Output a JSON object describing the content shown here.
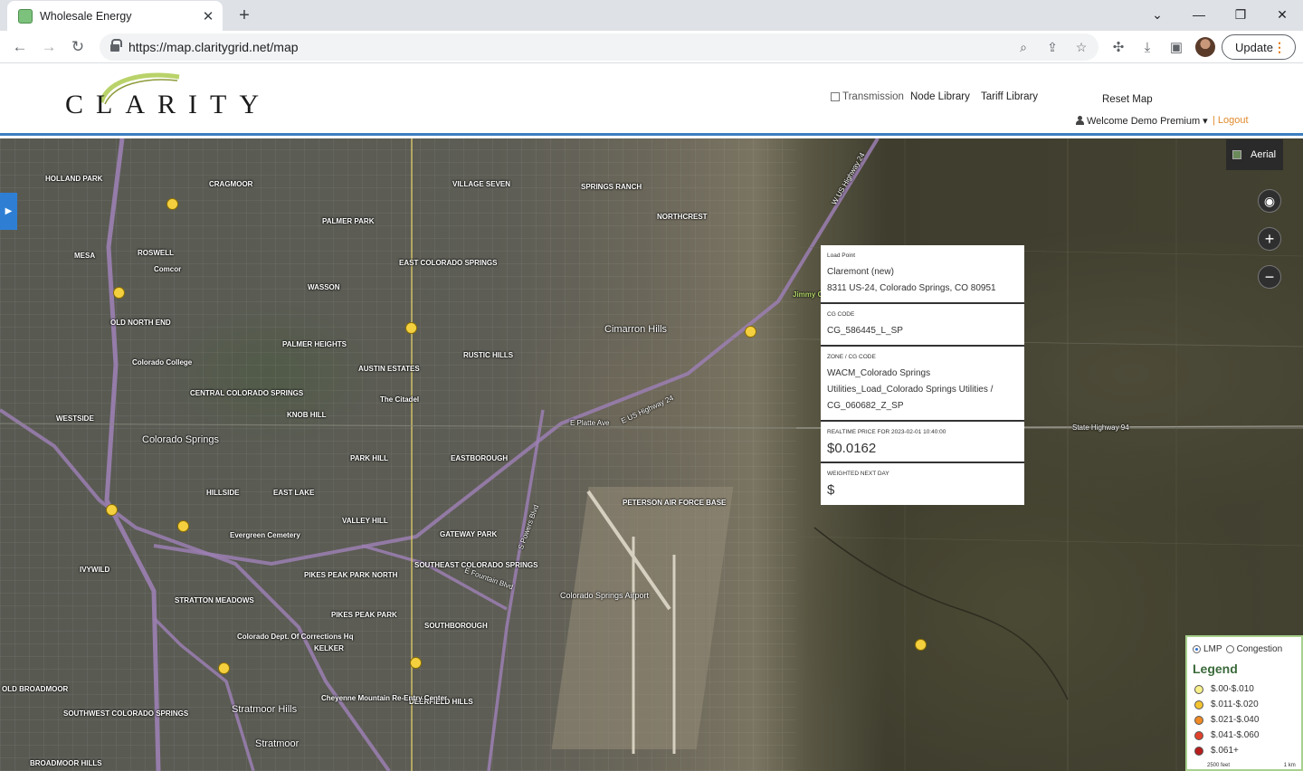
{
  "browser": {
    "tab_title": "Wholesale Energy",
    "url": "https://map.claritygrid.net/map",
    "update_label": "Update"
  },
  "header": {
    "logo_text": "CLARITY",
    "transmission_label": "Transmission",
    "node_library": "Node Library",
    "tariff_library": "Tariff Library",
    "reset_map": "Reset Map",
    "welcome": "Welcome Demo Premium",
    "logout": "| Logout"
  },
  "map": {
    "aerial_label": "Aerial",
    "labels": [
      "HOLLAND PARK",
      "CRAGMOOR",
      "ROSWELL",
      "Comcor",
      "MESA",
      "OLD NORTH END",
      "Colorado College",
      "CENTRAL COLORADO SPRINGS",
      "WESTSIDE",
      "Colorado Springs",
      "HILLSIDE",
      "Evergreen Cemetery",
      "IVYWILD",
      "STRATTON MEADOWS",
      "Colorado Dept. Of Corrections Hq",
      "KELKER",
      "OLD BROADMOOR",
      "SOUTHWEST COLORADO SPRINGS",
      "BROADMOOR HILLS",
      "Stratmoor Hills",
      "Stratmoor",
      "PALMER PARK",
      "WASSON",
      "PALMER HEIGHTS",
      "AUSTIN ESTATES",
      "The Citadel",
      "KNOB HILL",
      "PARK HILL",
      "EAST LAKE",
      "VALLEY HILL",
      "PIKES PEAK PARK NORTH",
      "PIKES PEAK PARK",
      "EAST COLORADO SPRINGS",
      "VILLAGE SEVEN",
      "SPRINGS RANCH",
      "NORTHCREST",
      "Cimarron Hills",
      "RUSTIC HILLS",
      "EASTBOROUGH",
      "GATEWAY PARK",
      "SOUTHEAST COLORADO SPRINGS",
      "SOUTHBOROUGH",
      "DEERFIELD HILLS",
      "Cheyenne Mountain Re-Entry Center",
      "PETERSON AIR FORCE BASE",
      "Colorado Springs Airport",
      "State Highway 94",
      "E Platte Ave",
      "E US Highway 24",
      "W US Highway 24",
      "S Powers Blvd",
      "E Fountain Blvd",
      "Jimmy C"
    ]
  },
  "popup": {
    "sections": [
      {
        "label": "Load Point",
        "lines": [
          "Claremont (new)",
          "8311 US-24, Colorado Springs, CO 80951"
        ]
      },
      {
        "label": "CG CODE",
        "lines": [
          "CG_586445_L_SP"
        ]
      },
      {
        "label": "ZONE / CG CODE",
        "lines": [
          "WACM_Colorado Springs",
          "Utilities_Load_Colorado Springs Utilities /",
          "CG_060682_Z_SP"
        ]
      },
      {
        "label": "REALTIME PRICE FOR 2023-02-01 10:40:00",
        "value": "$0.0162"
      },
      {
        "label": "WEIGHTED NEXT DAY",
        "value": "$"
      }
    ]
  },
  "legend": {
    "radio_lmp": "LMP",
    "radio_congestion": "Congestion",
    "title": "Legend",
    "items": [
      {
        "label": "$.00-$.010",
        "color": "#f7f08a"
      },
      {
        "label": "$.011-$.020",
        "color": "#f4c430"
      },
      {
        "label": "$.021-$.040",
        "color": "#f08a24"
      },
      {
        "label": "$.041-$.060",
        "color": "#e0422c"
      },
      {
        "label": "$.061+",
        "color": "#b81d1d"
      }
    ],
    "scale_feet": "2500 feet",
    "scale_km": "1 km"
  }
}
